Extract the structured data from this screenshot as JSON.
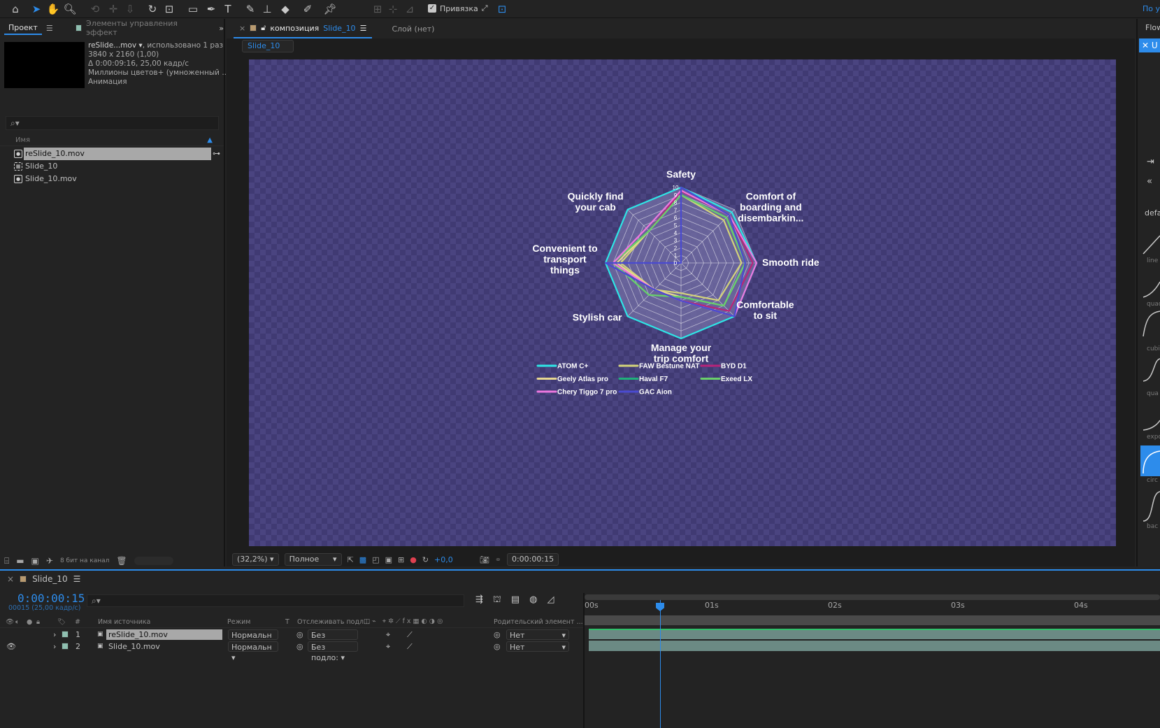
{
  "toolbar": {
    "snap_label": "Привязка",
    "top_right_label": "По у"
  },
  "project": {
    "tab_label": "Проект",
    "effects_tab_label": "Элементы управления эффект",
    "selected_name": "reSlide...mov",
    "selected_usage": ", использовано 1 раз",
    "meta_resolution": "3840 x 2160 (1,00)",
    "meta_duration": "Δ 0:00:09:16, 25,00 кадр/с",
    "meta_colors": "Миллионы цветов+ (умноженный ...",
    "meta_codec": "Анимация",
    "search_glyph": "⌕▾",
    "column_name": "Имя",
    "items": [
      {
        "name": "reSlide_10.mov",
        "icon": "footage-icon",
        "selected": true
      },
      {
        "name": "Slide_10",
        "icon": "composition-icon",
        "selected": false
      },
      {
        "name": "Slide_10.mov",
        "icon": "footage-icon",
        "selected": false
      }
    ],
    "bit_depth": "8 бит на канал"
  },
  "composition": {
    "tab_prefix": "композиция",
    "tab_name": "Slide_10",
    "layer_tab": "Слой (нет)",
    "breadcrumb": "Slide_10",
    "zoom": "(32,2%)",
    "resolution": "Полное",
    "exposure": "+0,0",
    "timecode": "0:00:00:15"
  },
  "chart_data": {
    "type": "radar",
    "axes": [
      "Safety",
      "Comfort of boarding and disembarkin...",
      "Smooth ride",
      "Comfortable to sit",
      "Manage your trip comfort",
      "Stylish car",
      "Convenient to transport things",
      "Quickly find your cab"
    ],
    "scale_max": 10,
    "tick_labels": [
      "10",
      "9",
      "8",
      "7",
      "6",
      "5",
      "4",
      "3",
      "2",
      "1",
      "0"
    ],
    "legend_columns": 3,
    "series": [
      {
        "name": "ATOM C+",
        "color": "#2ee6e6",
        "values": [
          10,
          9.5,
          10,
          10,
          10,
          10,
          10,
          10
        ]
      },
      {
        "name": "FAW Bestune NAT",
        "color": "#d4d47a",
        "values": [
          9,
          8,
          8,
          7,
          4,
          5,
          8,
          6
        ]
      },
      {
        "name": "BYD D1",
        "color": "#b8247a",
        "values": [
          9.5,
          9,
          9.5,
          9,
          5,
          5,
          9,
          6
        ]
      },
      {
        "name": "Geely Atlas pro",
        "color": "#e8d890",
        "values": [
          9,
          8.5,
          8.5,
          8,
          4.5,
          5,
          8.5,
          6
        ]
      },
      {
        "name": "Haval F7",
        "color": "#1fb07a",
        "values": [
          9,
          8.5,
          8.5,
          8,
          4.5,
          6,
          9,
          6
        ]
      },
      {
        "name": "Exeed LX",
        "color": "#6ad06a",
        "values": [
          9,
          8.5,
          8.5,
          8,
          4.5,
          6,
          9,
          6
        ]
      },
      {
        "name": "Chery Tiggo 7 pro",
        "color": "#ee78e0",
        "values": [
          9.6,
          9,
          10,
          10,
          5,
          5,
          9,
          6.5
        ]
      },
      {
        "name": "GAC Aion",
        "color": "#4a4ad0",
        "values": [
          10,
          9,
          8.5,
          10,
          5,
          5,
          10,
          0
        ]
      }
    ]
  },
  "rightpanel": {
    "flow_label": "Flow",
    "u_button": "✕ U",
    "default_label": "defa",
    "curves": [
      "line",
      "quad",
      "cubic",
      "qua",
      "expo",
      "circ",
      "bac"
    ]
  },
  "timeline": {
    "comp_name": "Slide_10",
    "timecode": "0:00:00:15",
    "frames_info": "00015 (25,00 кадр/с)",
    "search_glyph": "⌕▾",
    "col_number": "#",
    "col_source": "Имя источника",
    "col_mode": "Режим",
    "col_t": "T",
    "col_track": "Отслеживать подл...",
    "col_parent": "Родительский элемент ...",
    "layers": [
      {
        "num": "1",
        "name": "reSlide_10.mov",
        "mode": "Нормальн",
        "track": "Без подло:",
        "parent": "Нет",
        "selected": true
      },
      {
        "num": "2",
        "name": "Slide_10.mov",
        "mode": "Нормальн",
        "track": "Без подло:",
        "parent": "Нет",
        "selected": false
      }
    ],
    "ruler": [
      "00s",
      "01s",
      "02s",
      "03s",
      "04s"
    ]
  }
}
